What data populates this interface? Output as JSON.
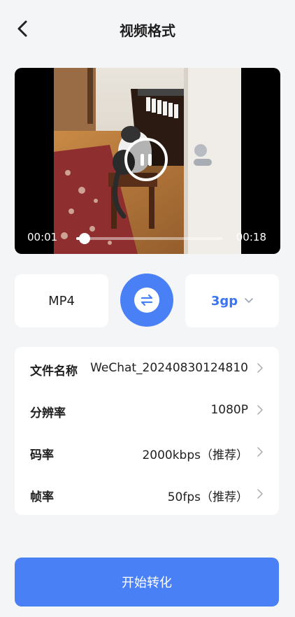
{
  "header": {
    "title": "视频格式"
  },
  "player": {
    "current_time": "00:01",
    "duration": "00:18",
    "progress": 0.056
  },
  "format": {
    "source": "MP4",
    "target": "3gp"
  },
  "settings": {
    "rows": [
      {
        "label": "文件名称",
        "value": "WeChat_20240830124810"
      },
      {
        "label": "分辨率",
        "value": "1080P"
      },
      {
        "label": "码率",
        "value": "2000kbps（推荐）"
      },
      {
        "label": "帧率",
        "value": "50fps（推荐）"
      }
    ]
  },
  "actions": {
    "start_label": "开始转化"
  },
  "colors": {
    "accent": "#4a80f6",
    "target_text": "#3a74f2",
    "background": "#f4f5f7"
  },
  "icons": {
    "back": "chevron-left-icon",
    "pause": "pause-icon",
    "swap": "swap-arrows-icon",
    "dropdown": "chevron-down-icon",
    "row_arrow": "chevron-right-icon"
  }
}
